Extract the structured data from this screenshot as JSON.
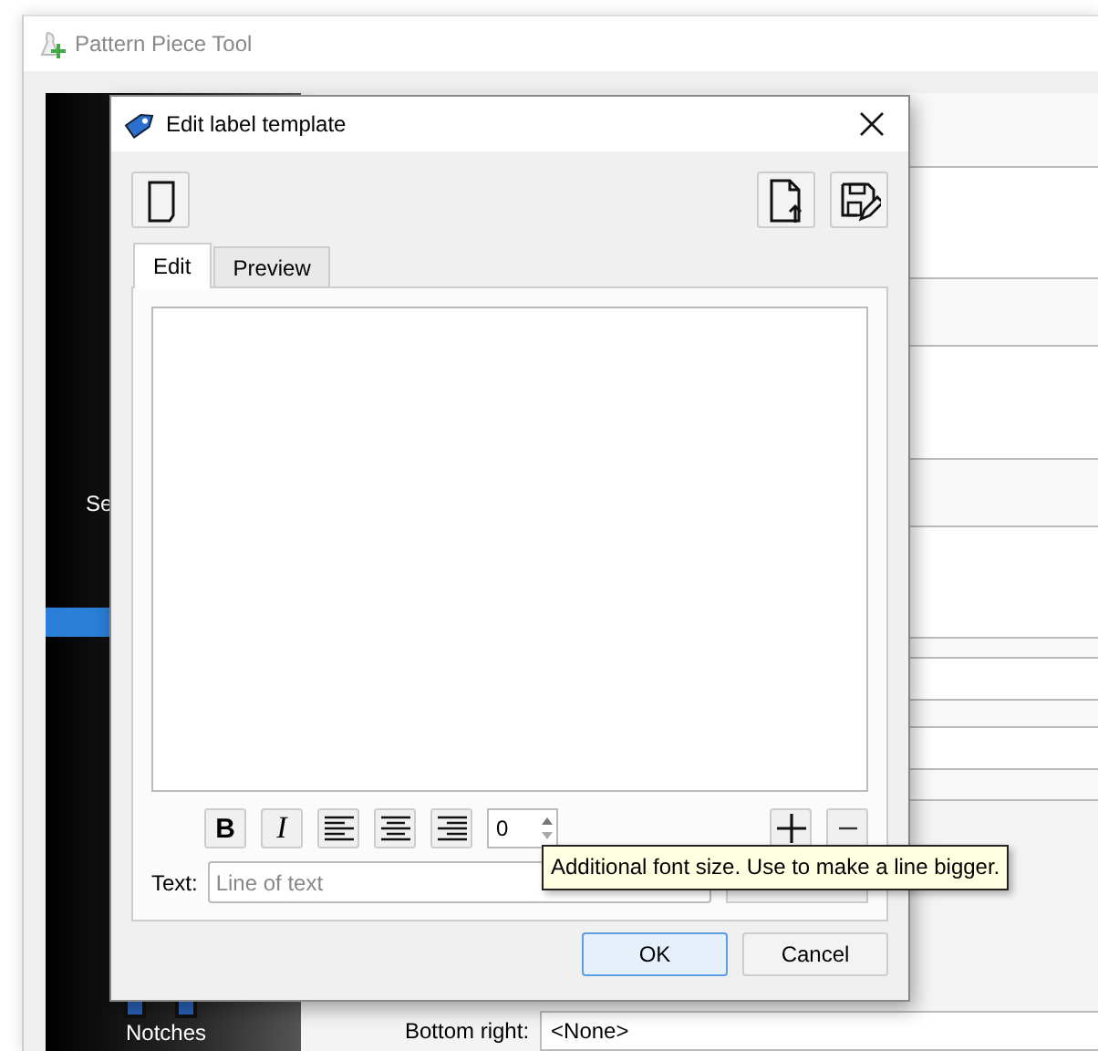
{
  "back_window": {
    "title": "Pattern Piece Tool",
    "sidebar": {
      "items": [
        {
          "label": "Se",
          "selected": false
        },
        {
          "selected": true
        },
        {
          "label": "Notches",
          "selected": false
        }
      ]
    },
    "bottom_right": {
      "label": "Bottom right:",
      "value": "<None>"
    }
  },
  "dialog": {
    "title": "Edit label template",
    "tabs": [
      {
        "label": "Edit",
        "selected": true
      },
      {
        "label": "Preview",
        "selected": false
      }
    ],
    "style_buttons": [
      {
        "kind": "bold",
        "glyph": "B"
      },
      {
        "kind": "italic",
        "glyph": "I"
      }
    ],
    "align_buttons": [
      {
        "kind": "left"
      },
      {
        "kind": "center"
      },
      {
        "kind": "right"
      }
    ],
    "font_size": {
      "value": "0"
    },
    "text_field": {
      "label": "Text:",
      "placeholder": "Line of text"
    },
    "buttons": [
      {
        "label": "OK",
        "default": true
      },
      {
        "label": "Cancel",
        "default": false
      }
    ]
  },
  "tooltip": {
    "text": "Additional font size. Use to make a line bigger."
  }
}
